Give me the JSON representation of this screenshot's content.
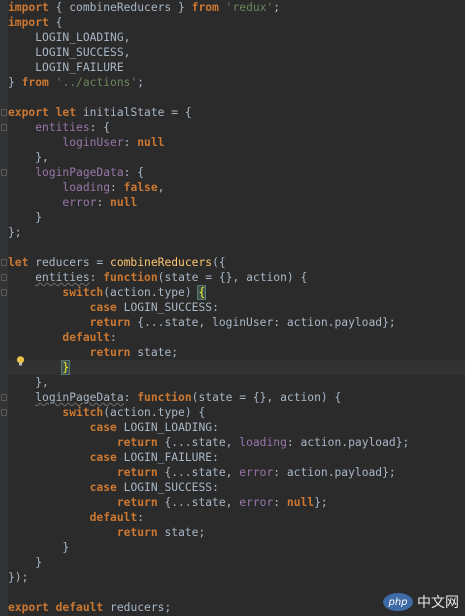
{
  "colors": {
    "background": "#2b2b2b",
    "keyword": "#cc7832",
    "string": "#6a8759",
    "property": "#9876aa",
    "function": "#ffc66d",
    "plain": "#a9b7c6"
  },
  "code_lines": [
    [
      [
        "kw",
        "import"
      ],
      [
        "pn",
        " { combineReducers } "
      ],
      [
        "kw",
        "from"
      ],
      [
        "pn",
        " "
      ],
      [
        "str",
        "'redux'"
      ],
      [
        "pn",
        ";"
      ]
    ],
    [
      [
        "kw",
        "import"
      ],
      [
        "pn",
        " {"
      ]
    ],
    [
      [
        "pn",
        "    "
      ],
      [
        "cst",
        "LOGIN_LOADING"
      ],
      [
        "pn",
        ","
      ]
    ],
    [
      [
        "pn",
        "    "
      ],
      [
        "cst",
        "LOGIN_SUCCESS"
      ],
      [
        "pn",
        ","
      ]
    ],
    [
      [
        "pn",
        "    "
      ],
      [
        "cst",
        "LOGIN_FAILURE"
      ]
    ],
    [
      [
        "pn",
        "} "
      ],
      [
        "kw",
        "from"
      ],
      [
        "pn",
        " "
      ],
      [
        "str",
        "'../actions'"
      ],
      [
        "pn",
        ";"
      ]
    ],
    [],
    [
      [
        "kw",
        "export"
      ],
      [
        "pn",
        " "
      ],
      [
        "kw",
        "let"
      ],
      [
        "pn",
        " initialState = {"
      ]
    ],
    [
      [
        "pn",
        "    "
      ],
      [
        "prop",
        "entities"
      ],
      [
        "pn",
        ": {"
      ]
    ],
    [
      [
        "pn",
        "        "
      ],
      [
        "prop",
        "loginUser"
      ],
      [
        "pn",
        ": "
      ],
      [
        "kw",
        "null"
      ]
    ],
    [
      [
        "pn",
        "    },"
      ]
    ],
    [
      [
        "pn",
        "    "
      ],
      [
        "prop",
        "loginPageData"
      ],
      [
        "pn",
        ": {"
      ]
    ],
    [
      [
        "pn",
        "        "
      ],
      [
        "prop",
        "loading"
      ],
      [
        "pn",
        ": "
      ],
      [
        "kw",
        "false"
      ],
      [
        "pn",
        ","
      ]
    ],
    [
      [
        "pn",
        "        "
      ],
      [
        "prop",
        "error"
      ],
      [
        "pn",
        ": "
      ],
      [
        "kw",
        "null"
      ]
    ],
    [
      [
        "pn",
        "    }"
      ]
    ],
    [
      [
        "pn",
        "};"
      ]
    ],
    [],
    [
      [
        "kw",
        "let"
      ],
      [
        "pn",
        " reducers = "
      ],
      [
        "fn",
        "combineReducers"
      ],
      [
        "pn",
        "({"
      ]
    ],
    [
      [
        "pn",
        "    "
      ],
      [
        "u",
        "entities"
      ],
      [
        "pn",
        ": "
      ],
      [
        "kw",
        "function"
      ],
      [
        "pn",
        "(state = {}, action) {"
      ]
    ],
    [
      [
        "pn",
        "        "
      ],
      [
        "kw",
        "switch"
      ],
      [
        "pn",
        "(action.type) "
      ],
      [
        "bm",
        "{"
      ]
    ],
    [
      [
        "pn",
        "            "
      ],
      [
        "kw",
        "case"
      ],
      [
        "pn",
        " "
      ],
      [
        "cst",
        "LOGIN_SUCCESS"
      ],
      [
        "pn",
        ":"
      ]
    ],
    [
      [
        "pn",
        "            "
      ],
      [
        "kw",
        "return"
      ],
      [
        "pn",
        " {...state, loginUser: action.payload};"
      ]
    ],
    [
      [
        "pn",
        "        "
      ],
      [
        "kw",
        "default"
      ],
      [
        "pn",
        ":"
      ]
    ],
    [
      [
        "pn",
        "            "
      ],
      [
        "kw",
        "return"
      ],
      [
        "pn",
        " state;"
      ]
    ],
    [
      [
        "pn",
        "        "
      ],
      [
        "bm",
        "}"
      ]
    ],
    [
      [
        "pn",
        "    },"
      ]
    ],
    [
      [
        "pn",
        "    "
      ],
      [
        "u",
        "loginPageData"
      ],
      [
        "pn",
        ": "
      ],
      [
        "kw",
        "function"
      ],
      [
        "pn",
        "(state = {}, action) {"
      ]
    ],
    [
      [
        "pn",
        "        "
      ],
      [
        "kw",
        "switch"
      ],
      [
        "pn",
        "(action.type) {"
      ]
    ],
    [
      [
        "pn",
        "            "
      ],
      [
        "kw",
        "case"
      ],
      [
        "pn",
        " "
      ],
      [
        "cst",
        "LOGIN_LOADING"
      ],
      [
        "pn",
        ":"
      ]
    ],
    [
      [
        "pn",
        "                "
      ],
      [
        "kw",
        "return"
      ],
      [
        "pn",
        " {...state, "
      ],
      [
        "prop",
        "loading"
      ],
      [
        "pn",
        ": action.payload};"
      ]
    ],
    [
      [
        "pn",
        "            "
      ],
      [
        "kw",
        "case"
      ],
      [
        "pn",
        " "
      ],
      [
        "cst",
        "LOGIN_FAILURE"
      ],
      [
        "pn",
        ":"
      ]
    ],
    [
      [
        "pn",
        "                "
      ],
      [
        "kw",
        "return"
      ],
      [
        "pn",
        " {...state, "
      ],
      [
        "prop",
        "error"
      ],
      [
        "pn",
        ": action.payload};"
      ]
    ],
    [
      [
        "pn",
        "            "
      ],
      [
        "kw",
        "case"
      ],
      [
        "pn",
        " "
      ],
      [
        "cst",
        "LOGIN_SUCCESS"
      ],
      [
        "pn",
        ":"
      ]
    ],
    [
      [
        "pn",
        "                "
      ],
      [
        "kw",
        "return"
      ],
      [
        "pn",
        " {...state, "
      ],
      [
        "prop",
        "error"
      ],
      [
        "pn",
        ": "
      ],
      [
        "kw",
        "null"
      ],
      [
        "pn",
        "};"
      ]
    ],
    [
      [
        "pn",
        "            "
      ],
      [
        "kw",
        "default"
      ],
      [
        "pn",
        ":"
      ]
    ],
    [
      [
        "pn",
        "                "
      ],
      [
        "kw",
        "return"
      ],
      [
        "pn",
        " state;"
      ]
    ],
    [
      [
        "pn",
        "        }"
      ]
    ],
    [
      [
        "pn",
        "    }"
      ]
    ],
    [
      [
        "pn",
        "});"
      ]
    ],
    [],
    [
      [
        "kw",
        "export"
      ],
      [
        "pn",
        " "
      ],
      [
        "kw",
        "default"
      ],
      [
        "pn",
        " reducers;"
      ]
    ]
  ],
  "current_line": 24,
  "watermark": {
    "logo": "php",
    "text": "中文网"
  }
}
